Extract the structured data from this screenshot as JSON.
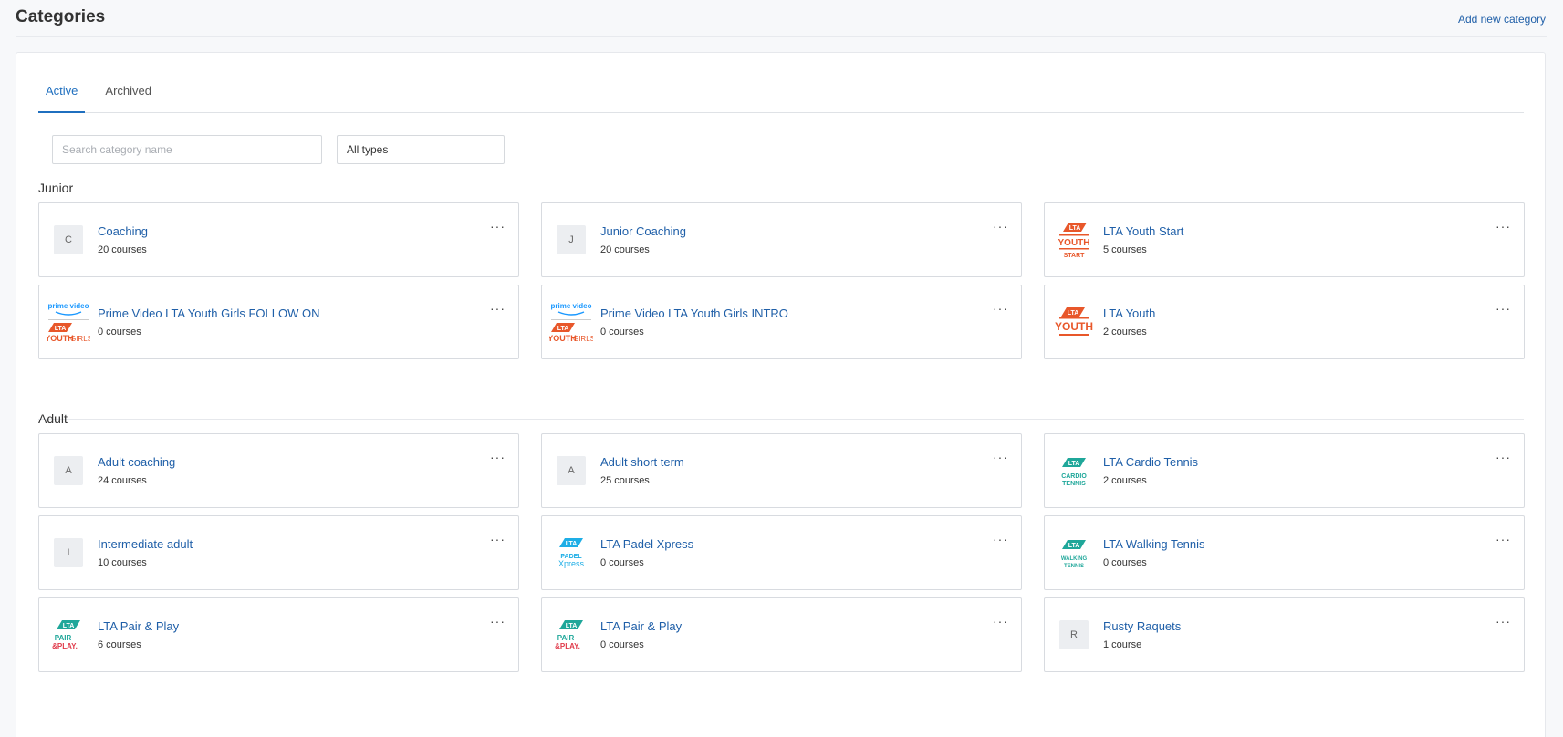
{
  "header": {
    "title": "Categories",
    "add_link": "Add new category"
  },
  "tabs": [
    {
      "label": "Active",
      "active": true
    },
    {
      "label": "Archived",
      "active": false
    }
  ],
  "filters": {
    "search_placeholder": "Search category name",
    "search_value": "",
    "type_select": "All types"
  },
  "sections": [
    {
      "title": "Junior",
      "cards": [
        {
          "name": "Coaching",
          "count": "20 courses",
          "thumb": "C"
        },
        {
          "name": "Junior Coaching",
          "count": "20 courses",
          "thumb": "J"
        },
        {
          "name": "LTA Youth Start",
          "count": "5 courses",
          "logo": "lta-youth-start-logo"
        },
        {
          "name": "Prime Video LTA Youth Girls FOLLOW ON",
          "count": "0 courses",
          "logo": "prime-video-youth-girls-logo"
        },
        {
          "name": "Prime Video LTA Youth Girls INTRO",
          "count": "0 courses",
          "logo": "prime-video-youth-girls-logo"
        },
        {
          "name": "LTA Youth",
          "count": "2 courses",
          "logo": "lta-youth-logo"
        }
      ]
    },
    {
      "title": "Adult",
      "cards": [
        {
          "name": "Adult coaching",
          "count": "24 courses",
          "thumb": "A"
        },
        {
          "name": "Adult short term",
          "count": "25 courses",
          "thumb": "A"
        },
        {
          "name": "LTA Cardio Tennis",
          "count": "2 courses",
          "logo": "lta-cardio-tennis-logo"
        },
        {
          "name": "Intermediate adult",
          "count": "10 courses",
          "thumb": "I"
        },
        {
          "name": "LTA Padel Xpress",
          "count": "0 courses",
          "logo": "lta-padel-xpress-logo"
        },
        {
          "name": "LTA Walking Tennis",
          "count": "0 courses",
          "logo": "lta-walking-tennis-logo"
        },
        {
          "name": "LTA Pair & Play",
          "count": "6 courses",
          "logo": "lta-pair-play-logo"
        },
        {
          "name": "LTA Pair & Play",
          "count": "0 courses",
          "logo": "lta-pair-play-logo"
        },
        {
          "name": "Rusty Raquets",
          "count": "1 course",
          "thumb": "R"
        }
      ]
    }
  ],
  "card_menu_glyph": "···",
  "logo_text": {
    "prime": "prime video",
    "youth": "YOUTH",
    "girls": "GIRLS",
    "start": "START",
    "lta": "LTA",
    "cardio": "CARDIO",
    "tennis": "TENNIS",
    "padel": "PADEL",
    "xpress": "Xpress",
    "walking": "WALKING",
    "pair": "PAIR",
    "play": "&PLAY."
  },
  "colors": {
    "link": "#1f5fa8",
    "tab_active": "#1f6fbf",
    "youth_orange": "#e8572a",
    "prime_blue": "#1a98ff",
    "lta_teal": "#1fa79a",
    "padel_blue": "#1eaee6",
    "play_red": "#e03a4a"
  }
}
